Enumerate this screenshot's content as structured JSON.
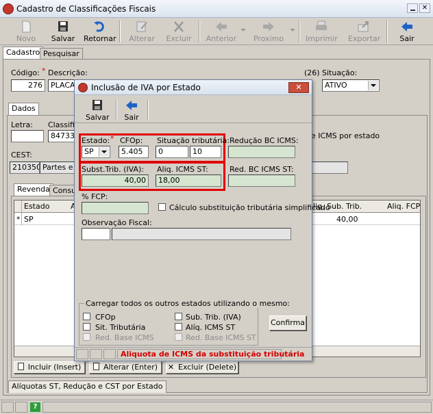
{
  "window": {
    "title": "Cadastro de Classificações Fiscais"
  },
  "toolbar": {
    "novo": "Novo",
    "salvar": "Salvar",
    "retornar": "Retornar",
    "alterar": "Alterar",
    "excluir": "Excluir",
    "anterior": "Anterior",
    "proximo": "Proximo",
    "imprimir": "Imprimir",
    "exportar": "Exportar",
    "sair": "Sair"
  },
  "tabs": {
    "cadastro": "Cadastro",
    "pesquisar": "Pesquisar"
  },
  "form": {
    "codigo_label": "Código:",
    "codigo_value": "276",
    "descricao_label": "Descrição:",
    "descricao_value": "PLACAS",
    "count": "(26)",
    "situacao_label": "Situação:",
    "situacao_value": "ATIVO",
    "dados_tab": "Dados",
    "letra_label": "Letra:",
    "classific_label": "Classific",
    "classific_value": "847330",
    "icms_estado": "e ICMS por estado",
    "cest_label": "CEST:",
    "cest_code": "210350",
    "cest_desc": "Partes e ac"
  },
  "subtabs": {
    "revenda": "Revenda",
    "consu": "Consu"
  },
  "grid": {
    "headers": {
      "estado": "Estado",
      "a": "A",
      "aliq_sub": "liq. Sub. Trib.",
      "aliq_fcp": "Aliq. FCP"
    },
    "row": {
      "marker": "*",
      "estado": "SP",
      "aliq_sub": "40,00"
    }
  },
  "bottom_buttons": {
    "incluir": "Incluir (Insert)",
    "alterar": "Alterar (Enter)",
    "excluir": "Excluir (Delete)"
  },
  "bottom_tab": "Alíquotas ST, Redução e CST por Estado",
  "dialog": {
    "title": "Inclusão de IVA por Estado",
    "salvar": "Salvar",
    "sair": "Sair",
    "estado_label": "Estado:",
    "estado_value": "SP",
    "cfop_label": "CFOp:",
    "cfop_value": "5.405",
    "situacao_label": "Situação tributária:",
    "situacao_a": "0",
    "situacao_b": "10",
    "reducao_label": "Redução BC ICMS:",
    "subst_label": "Subst.Trib. (IVA):",
    "subst_value": "40,00",
    "aliq_label": "Aliq. ICMS ST:",
    "aliq_value": "18,00",
    "red_label": "Red. BC ICMS ST:",
    "fcp_label": "% FCP:",
    "calculo_label": "Cálculo substituição tributária simplificado",
    "obs_label": "Observação Fiscal:",
    "carregar_label": "Carregar todos os outros estados utilizando o mesmo:",
    "chk_cfop": "CFOp",
    "chk_sub": "Sub. Trib. (IVA)",
    "chk_sit": "Sit. Tributária",
    "chk_aliq": "Alíq. ICMS ST",
    "chk_redbase": "Red. Base ICMS",
    "chk_redbase_st": "Red. Base ICMS ST",
    "confirma": "Confirma",
    "status": "Aliquota de ICMS da substituição tributária"
  },
  "colors": {
    "highlight": "#e00000",
    "green_field": "#d6e5d0",
    "title_bar": "#e6eef8"
  }
}
